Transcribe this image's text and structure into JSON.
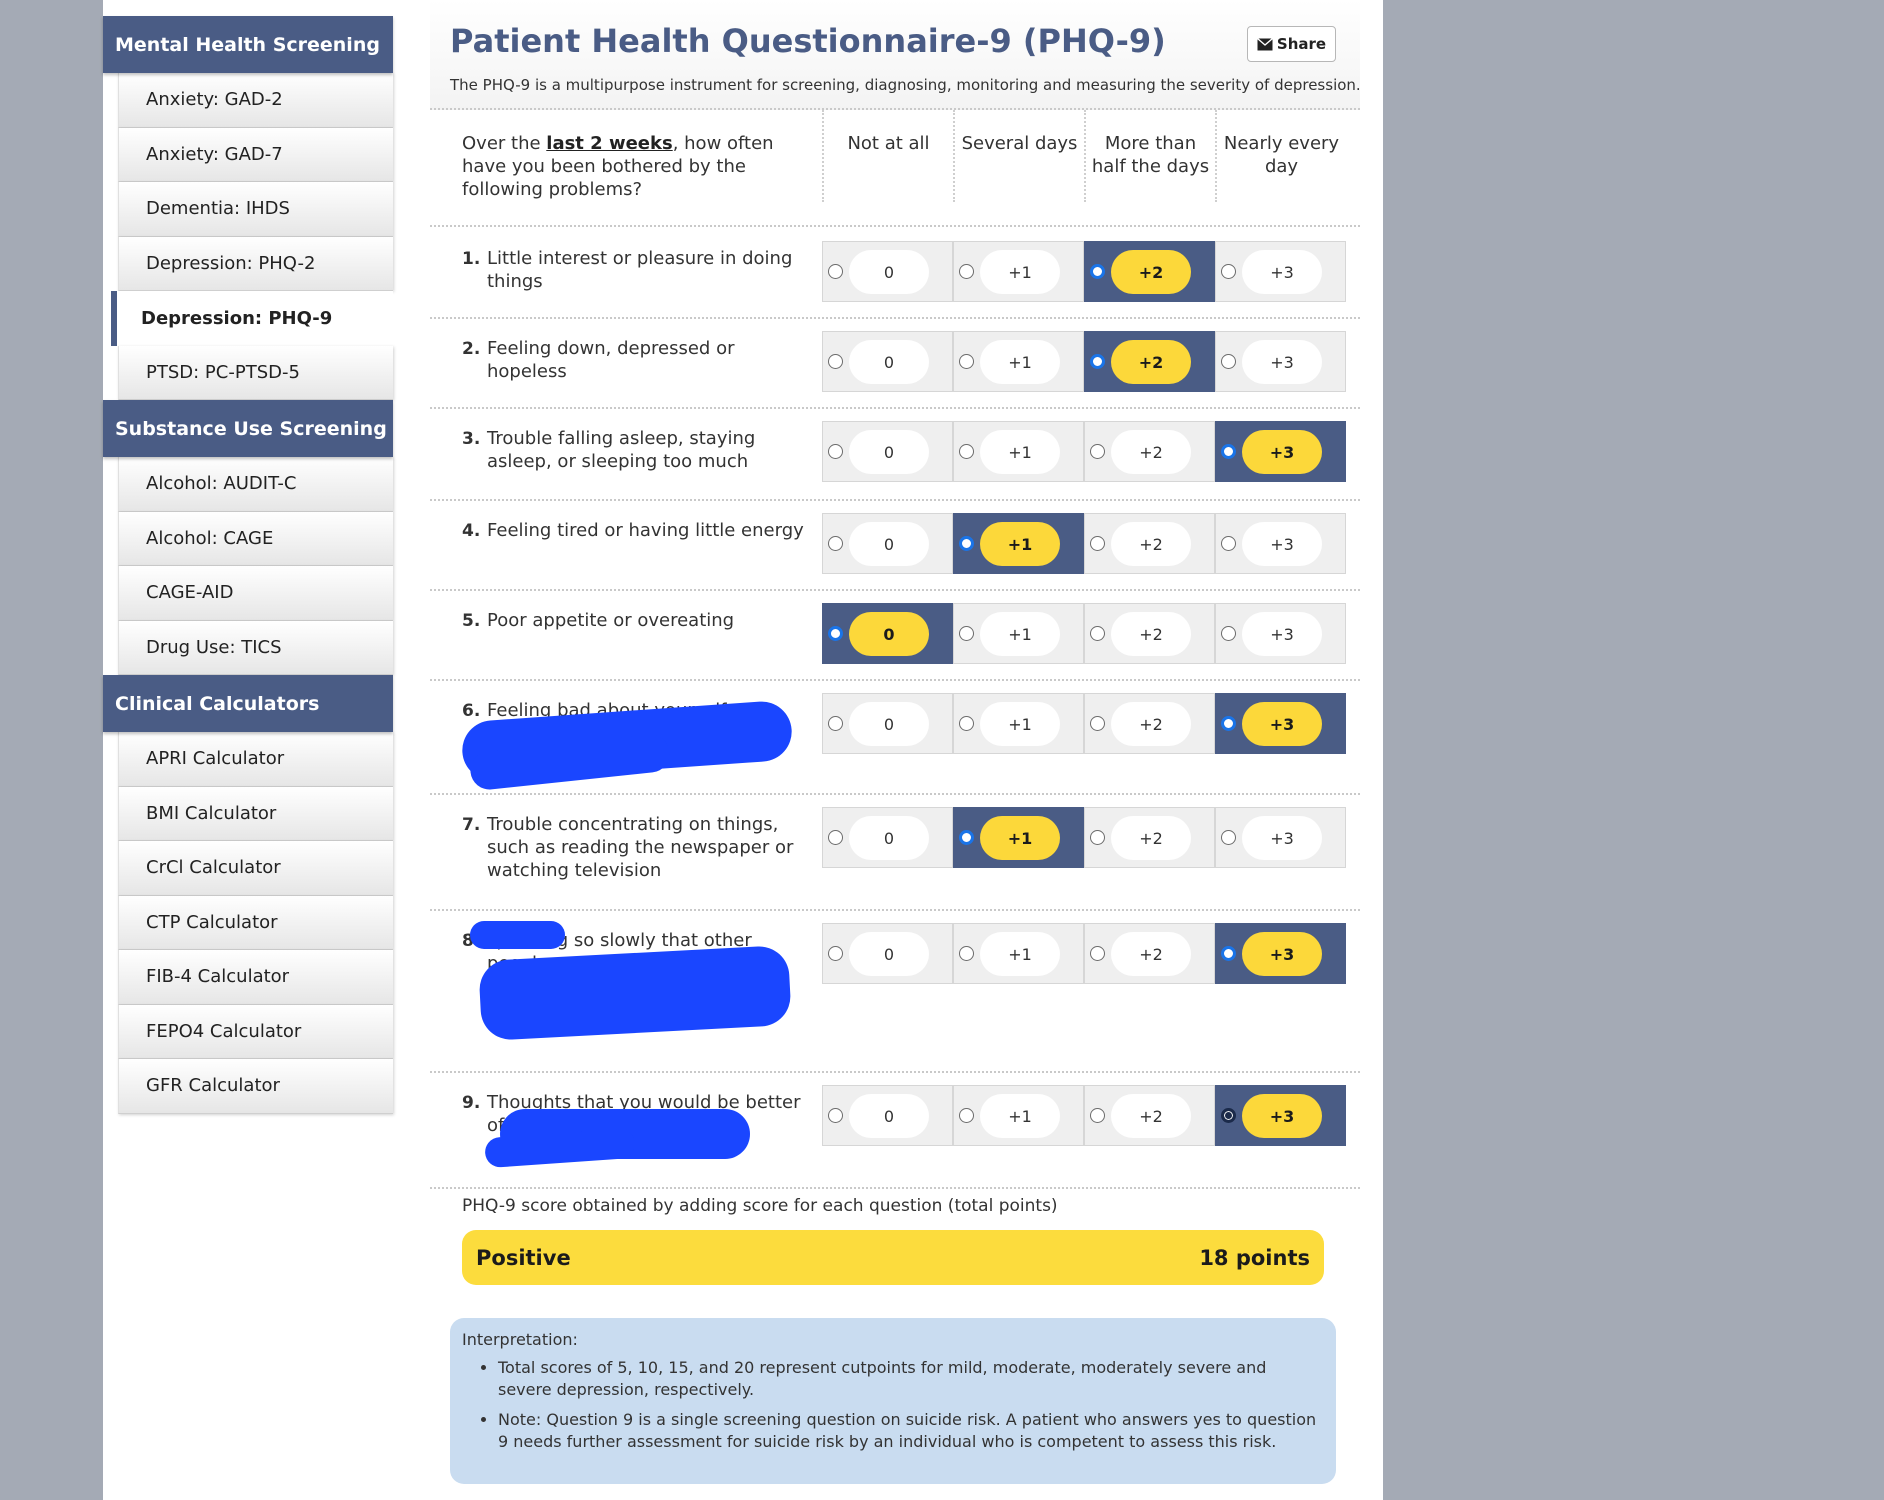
{
  "sidebar": {
    "sections": [
      {
        "title": "Mental Health Screening",
        "items": [
          "Anxiety: GAD-2",
          "Anxiety: GAD-7",
          "Dementia: IHDS",
          "Depression: PHQ-2",
          "Depression: PHQ-9",
          "PTSD: PC-PTSD-5"
        ]
      },
      {
        "title": "Substance Use Screening",
        "items": [
          "Alcohol: AUDIT-C",
          "Alcohol: CAGE",
          "CAGE-AID",
          "Drug Use: TICS"
        ]
      },
      {
        "title": "Clinical Calculators",
        "items": [
          "APRI Calculator",
          "BMI Calculator",
          "CrCl Calculator",
          "CTP Calculator",
          "FIB-4 Calculator",
          "FEPO4 Calculator",
          "GFR Calculator"
        ]
      }
    ],
    "active_item": "Depression: PHQ-9"
  },
  "header": {
    "title": "Patient Health Questionnaire-9 (PHQ-9)",
    "share_label": "Share",
    "share_icon": "envelope-icon",
    "subtitle": "The PHQ-9 is a multipurpose instrument for screening, diagnosing, monitoring and measuring the severity of depression."
  },
  "table": {
    "prompt_before": "Over the ",
    "prompt_emph": "last 2 weeks",
    "prompt_after": ", how often have you been bothered by the following problems?",
    "columns": [
      "Not at all",
      "Several days",
      "More than half the days",
      "Nearly every day"
    ],
    "option_labels": [
      "0",
      "+1",
      "+2",
      "+3"
    ],
    "questions": [
      {
        "num": "1.",
        "text": "Little interest or pleasure in doing things",
        "selected": 2
      },
      {
        "num": "2.",
        "text": "Feeling down, depressed or hopeless",
        "selected": 2
      },
      {
        "num": "3.",
        "text": "Trouble falling asleep, staying asleep, or sleeping too much",
        "selected": 3
      },
      {
        "num": "4.",
        "text": "Feeling tired or having little energy",
        "selected": 1
      },
      {
        "num": "5.",
        "text": "Poor appetite or overeating",
        "selected": 0
      },
      {
        "num": "6.",
        "text": "Feeling bad about yourself -",
        "selected": 3
      },
      {
        "num": "7.",
        "text": "Trouble concentrating on things, such as reading the newspaper or watching television",
        "selected": 1
      },
      {
        "num": "8.",
        "text": "speaking so slowly that other people could have noticed",
        "selected": 3
      },
      {
        "num": "9.",
        "text": "Thoughts that you would be better off dead",
        "selected": 3
      }
    ]
  },
  "score": {
    "label": "PHQ-9 score obtained by adding score for each question (total points)",
    "result": "Positive",
    "points": "18 points"
  },
  "interpretation": {
    "title": "Interpretation:",
    "items": [
      "Total scores of 5, 10, 15, and 20 represent cutpoints for mild, moderate, moderately severe and severe depression, respectively.",
      "Note: Question 9 is a single screening question on suicide risk. A patient who answers yes to question 9 needs further assessment for suicide risk by an individual who is competent to assess this risk."
    ]
  },
  "colors": {
    "brand_navy": "#4a5c85",
    "selected_pill": "#fcd83a",
    "interpretation_bg": "#c9dcf0"
  }
}
